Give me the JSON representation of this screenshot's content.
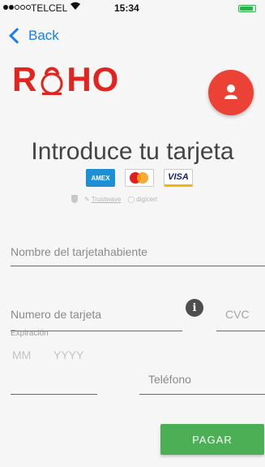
{
  "status_bar": {
    "signal_dots_filled": 2,
    "signal_dots_total": 5,
    "carrier": "TELCEL",
    "time": "15:34",
    "battery_level": 0.9
  },
  "nav": {
    "back_label": "Back"
  },
  "logo": {
    "left": "R",
    "right": "HO"
  },
  "profile_button": {
    "icon": "user-icon",
    "color": "#eb4235"
  },
  "title": "Introduce tu tarjeta",
  "card_logos": {
    "amex": "AMEX",
    "visa": "VISA"
  },
  "security_badges": {
    "trustwave": "Trustwave",
    "digicert": "digicert"
  },
  "form": {
    "cardholder_placeholder": "Nombre del tarjetahabiente",
    "card_number_placeholder": "Numero de tarjeta",
    "cvc_placeholder": "CVC",
    "expiration_label": "Expiración",
    "month_placeholder": "MM",
    "year_placeholder": "YYYY",
    "phone_placeholder": "Teléfono",
    "info_icon": "info-icon"
  },
  "pay_button": {
    "label": "PAGAR",
    "color": "#4cae55"
  },
  "colors": {
    "accent_blue": "#1a7ef2",
    "brand_red": "#e2241f"
  }
}
